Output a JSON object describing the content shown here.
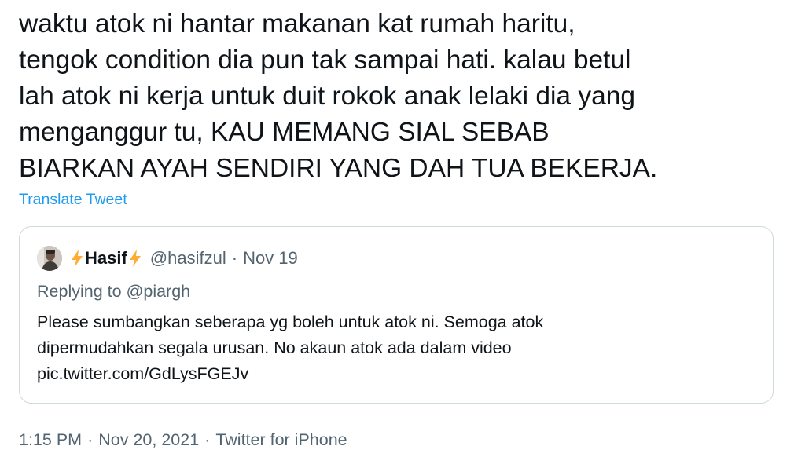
{
  "tweet": {
    "text_lines": [
      "waktu atok ni hantar makanan kat rumah haritu,",
      "tengok condition dia pun tak sampai hati. kalau betul",
      "lah atok ni kerja untuk duit rokok anak lelaki dia yang",
      "menganggur tu, KAU MEMANG SIAL SEBAB",
      "BIARKAN AYAH SENDIRI YANG DAH TUA BEKERJA."
    ],
    "translate_label": "Translate Tweet"
  },
  "quoted_tweet": {
    "display_name": "Hasif",
    "name_icon": "lightning-bolt-emoji",
    "handle": "@hasifzul",
    "separator": "·",
    "date": "Nov 19",
    "replying_to": "Replying to @piargh",
    "body_lines": [
      "Please sumbangkan seberapa yg boleh untuk atok ni. Semoga atok",
      "dipermudahkan segala urusan. No akaun atok ada dalam video",
      "pic.twitter.com/GdLysFGEJv"
    ]
  },
  "meta": {
    "time": "1:15 PM",
    "separator": "·",
    "date": "Nov 20, 2021",
    "source": "Twitter for iPhone"
  },
  "colors": {
    "text": "#0f1419",
    "secondary": "#536471",
    "link": "#1d9bf0",
    "border": "#cfd9de",
    "bolt": "#ffac33"
  }
}
